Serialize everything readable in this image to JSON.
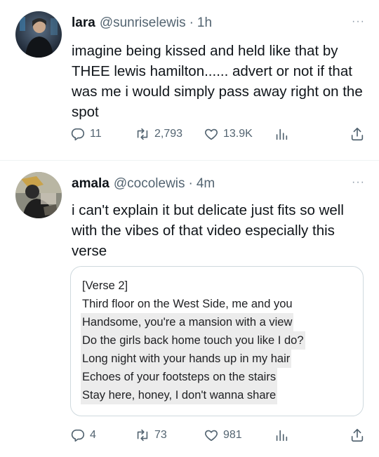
{
  "tweets": [
    {
      "name": "lara",
      "handle": "@sunriselewis",
      "time": "1h",
      "text": "imagine being kissed and held like that by THEE lewis hamilton...... advert or not if that was me i would simply pass away right on the spot",
      "replies": "11",
      "retweets": "2,793",
      "likes": "13.9K"
    },
    {
      "name": "amala",
      "handle": "@cocolewis",
      "time": "4m",
      "text": "i can't explain it but delicate just fits so well with the vibes of that video especially this verse",
      "replies": "4",
      "retweets": "73",
      "likes": "981",
      "lyrics": [
        "[Verse 2]",
        "Third floor on the West Side, me and you",
        "Handsome, you're a mansion with a view",
        "Do the girls back home touch you like I do?",
        "Long night with your hands up in my hair",
        "Echoes of your footsteps on the stairs",
        "Stay here, honey, I don't wanna share"
      ]
    }
  ],
  "ui": {
    "dot": "·",
    "more": "···"
  },
  "icons": {
    "reply": "reply-icon",
    "retweet": "retweet-icon",
    "like": "heart-icon",
    "views": "views-chart-icon",
    "share": "share-icon"
  },
  "colors": {
    "text": "#0f1419",
    "muted": "#536471",
    "border": "#cfd9de"
  }
}
